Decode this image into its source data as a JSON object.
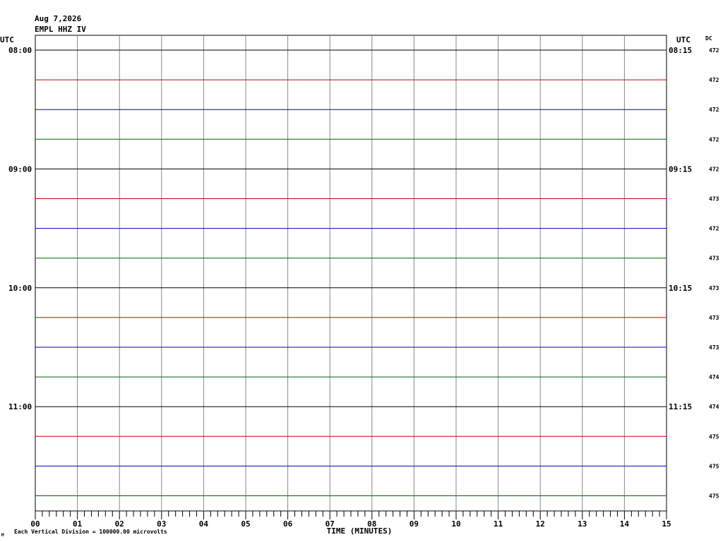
{
  "header": {
    "date": "Aug 7,2026",
    "station": "EMPL HHZ IV",
    "utc_left": "UTC",
    "utc_right": "UTC",
    "dc_label": "DC"
  },
  "footer": {
    "scale_note": "Each Vertical Division = 100000.00 microvolts",
    "x_axis_title": "TIME (MINUTES)",
    "mark": "M"
  },
  "colors": {
    "trace_cycle": [
      "#000000",
      "#cc0000",
      "#0000cc",
      "#006600"
    ],
    "grid": "#888888"
  },
  "chart_data": {
    "type": "line",
    "title": "EMPL HHZ IV",
    "xlabel": "TIME (MINUTES)",
    "x_range": [
      0,
      15
    ],
    "x_ticks": [
      "00",
      "01",
      "02",
      "03",
      "04",
      "05",
      "06",
      "07",
      "08",
      "09",
      "10",
      "11",
      "12",
      "13",
      "14",
      "15"
    ],
    "left_hour_labels": [
      "08:00",
      "09:00",
      "10:00",
      "11:00"
    ],
    "right_hour_labels": [
      "08:15",
      "09:15",
      "10:15",
      "11:15"
    ],
    "trace_count": 16,
    "dc_values": [
      "472",
      "472",
      "472",
      "472",
      "472",
      "473",
      "472",
      "473",
      "473",
      "473",
      "473",
      "474",
      "474",
      "475",
      "475",
      "475"
    ],
    "series": [],
    "grid": true
  }
}
